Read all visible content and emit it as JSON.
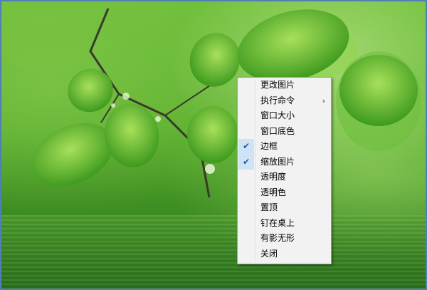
{
  "menu": {
    "items": [
      {
        "label": "更改图片",
        "checked": false,
        "submenu": false
      },
      {
        "label": "执行命令",
        "checked": false,
        "submenu": true
      },
      {
        "label": "窗口大小",
        "checked": false,
        "submenu": false
      },
      {
        "label": "窗口底色",
        "checked": false,
        "submenu": false
      },
      {
        "label": "边框",
        "checked": true,
        "submenu": false
      },
      {
        "label": "缩放图片",
        "checked": true,
        "submenu": false
      },
      {
        "label": "透明度",
        "checked": false,
        "submenu": false
      },
      {
        "label": "透明色",
        "checked": false,
        "submenu": false
      },
      {
        "label": "置顶",
        "checked": false,
        "submenu": false
      },
      {
        "label": "钉在桌上",
        "checked": false,
        "submenu": false
      },
      {
        "label": "有影无形",
        "checked": false,
        "submenu": false
      },
      {
        "label": "关闭",
        "checked": false,
        "submenu": false
      }
    ],
    "check_glyph": "✔",
    "submenu_glyph": "›"
  },
  "colors": {
    "menu_bg": "#f2f2f2",
    "checked_bg": "#cfe3f7",
    "check_color": "#1e5aa8",
    "frame_border": "#4f7fb6"
  }
}
